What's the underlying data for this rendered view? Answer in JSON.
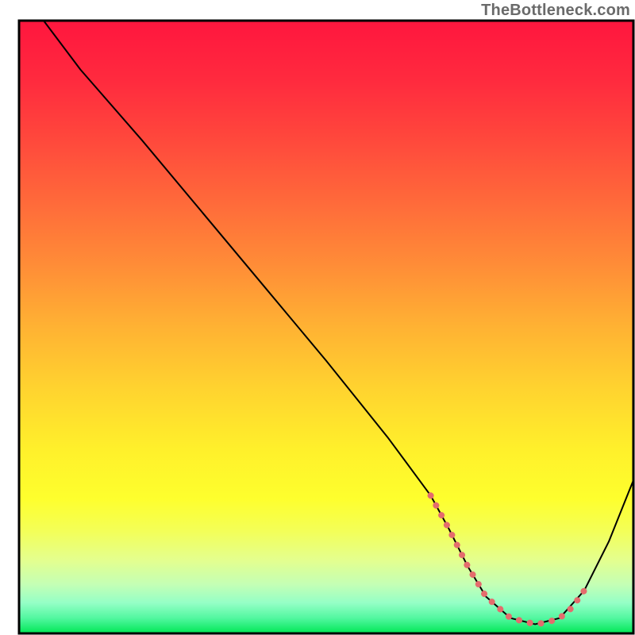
{
  "watermark": "TheBottleneck.com",
  "chart_data": {
    "type": "line",
    "title": "",
    "xlabel": "",
    "ylabel": "",
    "xlim": [
      0,
      100
    ],
    "ylim": [
      0,
      100
    ],
    "grid": false,
    "legend": false,
    "background_gradient_stops": [
      {
        "offset": 0.0,
        "color": "#ff163e"
      },
      {
        "offset": 0.1,
        "color": "#ff2b3e"
      },
      {
        "offset": 0.2,
        "color": "#ff4a3c"
      },
      {
        "offset": 0.3,
        "color": "#ff6b3a"
      },
      {
        "offset": 0.4,
        "color": "#ff8d37"
      },
      {
        "offset": 0.5,
        "color": "#ffb233"
      },
      {
        "offset": 0.6,
        "color": "#ffd32f"
      },
      {
        "offset": 0.7,
        "color": "#fff02b"
      },
      {
        "offset": 0.78,
        "color": "#feff2d"
      },
      {
        "offset": 0.83,
        "color": "#f4ff55"
      },
      {
        "offset": 0.88,
        "color": "#e4ff8e"
      },
      {
        "offset": 0.92,
        "color": "#c4ffb5"
      },
      {
        "offset": 0.95,
        "color": "#95ffc6"
      },
      {
        "offset": 0.975,
        "color": "#52f7a0"
      },
      {
        "offset": 1.0,
        "color": "#00e755"
      }
    ],
    "series": [
      {
        "name": "bottleneck-curve",
        "color": "#000000",
        "stroke_width": 2,
        "x": [
          4,
          10,
          20,
          30,
          40,
          50,
          60,
          67,
          70,
          73,
          76,
          80,
          84,
          88,
          92,
          96,
          100
        ],
        "values": [
          100,
          92,
          80.5,
          68.5,
          56.5,
          44.5,
          32.0,
          22.5,
          17.0,
          11.0,
          6.0,
          2.5,
          1.5,
          2.5,
          7.0,
          15.0,
          25.0
        ]
      },
      {
        "name": "optimal-band",
        "color": "#e46c6d",
        "stroke_width": 8,
        "linecap": "round",
        "dash": "0.1 14",
        "x": [
          67,
          70,
          73,
          76,
          80,
          84,
          86,
          88,
          90,
          92
        ],
        "values": [
          22.5,
          17.0,
          11.0,
          6.0,
          2.5,
          1.5,
          1.8,
          2.5,
          4.2,
          7.0
        ]
      }
    ]
  }
}
